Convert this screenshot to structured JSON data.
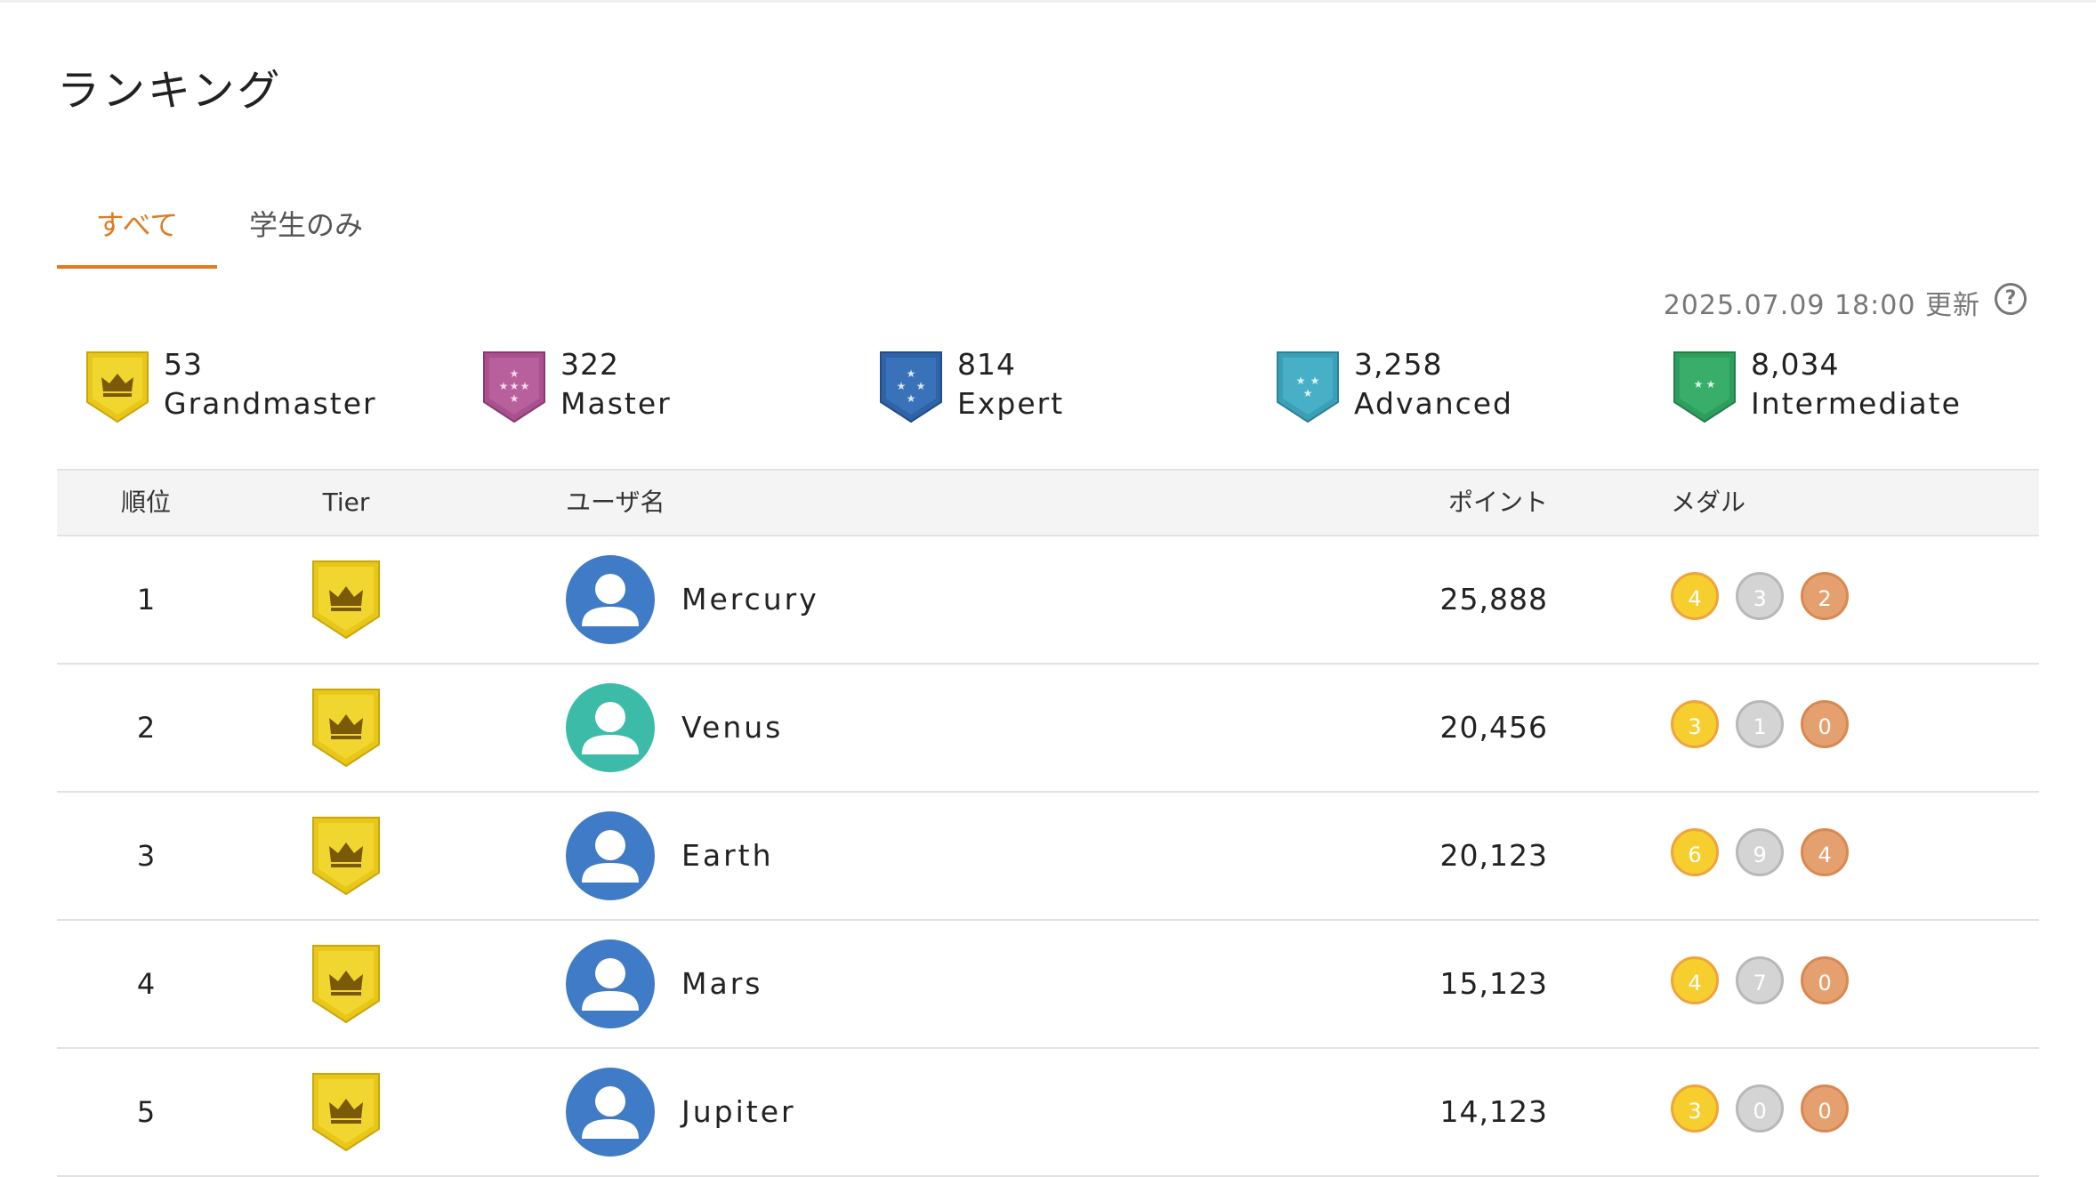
{
  "page": {
    "title": "ランキング"
  },
  "tabs": [
    {
      "label": "すべて",
      "active": true
    },
    {
      "label": "学生のみ",
      "active": false
    }
  ],
  "updated": {
    "text": "2025.07.09 18:00 更新"
  },
  "help_icon": "help-circle-icon",
  "colors": {
    "accent": "#e07a1f",
    "grandmaster": "#e8c719",
    "master": "#a9508e",
    "expert": "#2f63a8",
    "advanced": "#3aa0b6",
    "intermediate": "#2e9e5d",
    "avatar_blue": "#3f7bc6",
    "avatar_teal": "#3cbca8",
    "medal_gold": "#f6cf2f",
    "medal_silver": "#d4d4d4",
    "medal_bronze": "#e4a06e"
  },
  "tiers": [
    {
      "count": "53",
      "name": "Grandmaster",
      "icon": "grandmaster-crown-shield-icon"
    },
    {
      "count": "322",
      "name": "Master",
      "icon": "master-star-shield-icon"
    },
    {
      "count": "814",
      "name": "Expert",
      "icon": "expert-star-shield-icon"
    },
    {
      "count": "3,258",
      "name": "Advanced",
      "icon": "advanced-star-shield-icon"
    },
    {
      "count": "8,034",
      "name": "Intermediate",
      "icon": "intermediate-star-shield-icon"
    }
  ],
  "table": {
    "headers": {
      "rank": "順位",
      "tier": "Tier",
      "user": "ユーザ名",
      "points": "ポイント",
      "medals": "メダル"
    },
    "rows": [
      {
        "rank": "1",
        "tier": "Grandmaster",
        "avatar": "blue",
        "user": "Mercury",
        "points": "25,888",
        "gold": "4",
        "silver": "3",
        "bronze": "2"
      },
      {
        "rank": "2",
        "tier": "Grandmaster",
        "avatar": "teal",
        "user": "Venus",
        "points": "20,456",
        "gold": "3",
        "silver": "1",
        "bronze": "0"
      },
      {
        "rank": "3",
        "tier": "Grandmaster",
        "avatar": "blue",
        "user": "Earth",
        "points": "20,123",
        "gold": "6",
        "silver": "9",
        "bronze": "4"
      },
      {
        "rank": "4",
        "tier": "Grandmaster",
        "avatar": "blue",
        "user": "Mars",
        "points": "15,123",
        "gold": "4",
        "silver": "7",
        "bronze": "0"
      },
      {
        "rank": "5",
        "tier": "Grandmaster",
        "avatar": "blue",
        "user": "Jupiter",
        "points": "14,123",
        "gold": "3",
        "silver": "0",
        "bronze": "0"
      }
    ]
  }
}
